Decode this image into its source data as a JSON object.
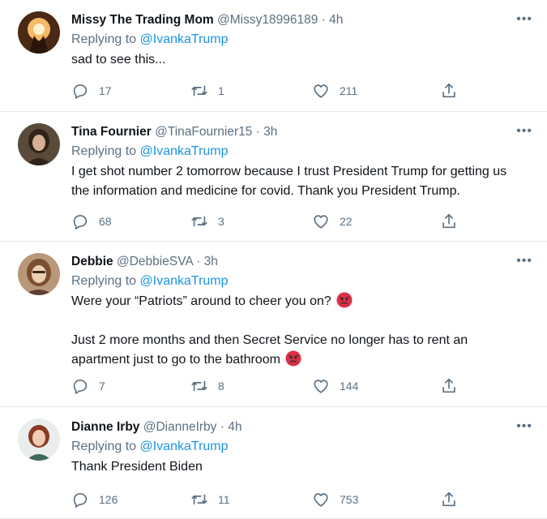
{
  "tweets": [
    {
      "name": "Missy The Trading Mom",
      "handle": "@Missy18996189",
      "sep": "·",
      "time": "4h",
      "replying_prefix": "Replying to ",
      "replying_to": "@IvankaTrump",
      "paragraphs": [
        "sad to see this..."
      ],
      "replies": "17",
      "retweets": "1",
      "likes": "211",
      "avatar_colors": [
        "#6b3c1e",
        "#f4a55a"
      ]
    },
    {
      "name": "Tina Fournier",
      "handle": "@TinaFournier15",
      "sep": "·",
      "time": "3h",
      "replying_prefix": "Replying to ",
      "replying_to": "@IvankaTrump",
      "paragraphs": [
        "I get shot number 2 tomorrow because I trust President Trump for getting us the information and medicine for covid.  Thank you President Trump."
      ],
      "replies": "68",
      "retweets": "3",
      "likes": "22",
      "avatar_colors": [
        "#3a2e22",
        "#c8a888"
      ]
    },
    {
      "name": "Debbie",
      "handle": "@DebbieSVA",
      "sep": "·",
      "time": "3h",
      "replying_prefix": "Replying to ",
      "replying_to": "@IvankaTrump",
      "paragraphs": [
        "Were your “Patriots” around to cheer you on?",
        "Just 2 more months and then Secret Service no longer has to rent an apartment just to go to the bathroom"
      ],
      "replies": "7",
      "retweets": "8",
      "likes": "144",
      "avatar_colors": [
        "#8a6a4a",
        "#e4c2a4"
      ]
    },
    {
      "name": "Dianne Irby",
      "handle": "@DianneIrby",
      "sep": "·",
      "time": "4h",
      "replying_prefix": "Replying to ",
      "replying_to": "@IvankaTrump",
      "paragraphs": [
        "Thank President Biden"
      ],
      "replies": "126",
      "retweets": "11",
      "likes": "753",
      "avatar_colors": [
        "#e8ecea",
        "#7a3a2a"
      ]
    }
  ],
  "icons": {
    "more": "more-icon",
    "reply": "reply-icon",
    "retweet": "retweet-icon",
    "like": "like-icon",
    "share": "share-icon",
    "emoji": "angry-face-emoji"
  },
  "colors": {
    "mention": "#1b95e0",
    "secondary_text": "#5b7083",
    "divider": "#e6ecf0"
  }
}
